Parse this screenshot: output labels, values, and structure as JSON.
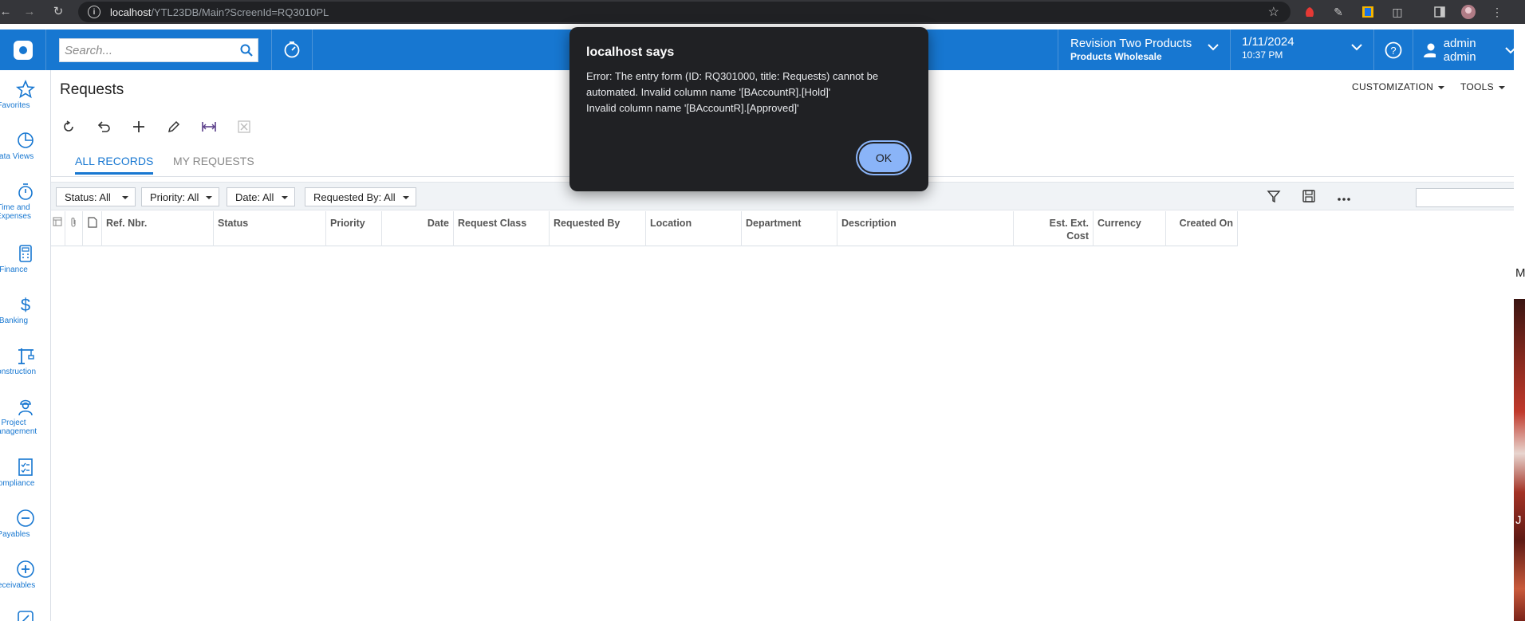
{
  "browser": {
    "url_host": "localhost",
    "url_path": "/YTL23DB/Main?ScreenId=RQ3010PL"
  },
  "topbar": {
    "search_placeholder": "Search...",
    "company_name": "Revision Two Products",
    "branch_name": "Products Wholesale",
    "date": "1/11/2024",
    "time": "10:37 PM",
    "user_name": "admin admin"
  },
  "sidebar": {
    "items": [
      {
        "label": "Favorites",
        "icon": "star-icon"
      },
      {
        "label": "Data Views",
        "icon": "pie-chart-icon"
      },
      {
        "label": "Time and\nExpenses",
        "icon": "stopwatch-icon"
      },
      {
        "label": "Finance",
        "icon": "calculator-icon"
      },
      {
        "label": "Banking",
        "icon": "dollar-icon"
      },
      {
        "label": "Construction",
        "icon": "crane-icon"
      },
      {
        "label": "Project\nManagement",
        "icon": "worker-icon"
      },
      {
        "label": "Compliance",
        "icon": "checklist-icon"
      },
      {
        "label": "Payables",
        "icon": "minus-circle-icon"
      },
      {
        "label": "Receivables",
        "icon": "plus-circle-icon"
      }
    ]
  },
  "page": {
    "title": "Requests",
    "customization_label": "CUSTOMIZATION",
    "tools_label": "TOOLS"
  },
  "tabs": [
    {
      "label": "ALL RECORDS",
      "active": true
    },
    {
      "label": "MY REQUESTS",
      "active": false
    }
  ],
  "filters": [
    {
      "label": "Status: All"
    },
    {
      "label": "Priority: All"
    },
    {
      "label": "Date: All"
    },
    {
      "label": "Requested By: All"
    }
  ],
  "grid": {
    "columns": [
      "Ref. Nbr.",
      "Status",
      "Priority",
      "Date",
      "Request Class",
      "Requested By",
      "Location",
      "Department",
      "Description",
      "Est. Ext.\nCost",
      "Currency",
      "Created On"
    ]
  },
  "dialog": {
    "title": "localhost says",
    "message": "Error: The entry form (ID: RQ301000, title: Requests) cannot be automated. Invalid column name '[BAccountR].[Hold]'\nInvalid column name '[BAccountR].[Approved]'",
    "ok_label": "OK"
  },
  "colors": {
    "accent": "#1777d1",
    "dialog_bg": "#202124",
    "ok_button": "#8ab4f8"
  }
}
